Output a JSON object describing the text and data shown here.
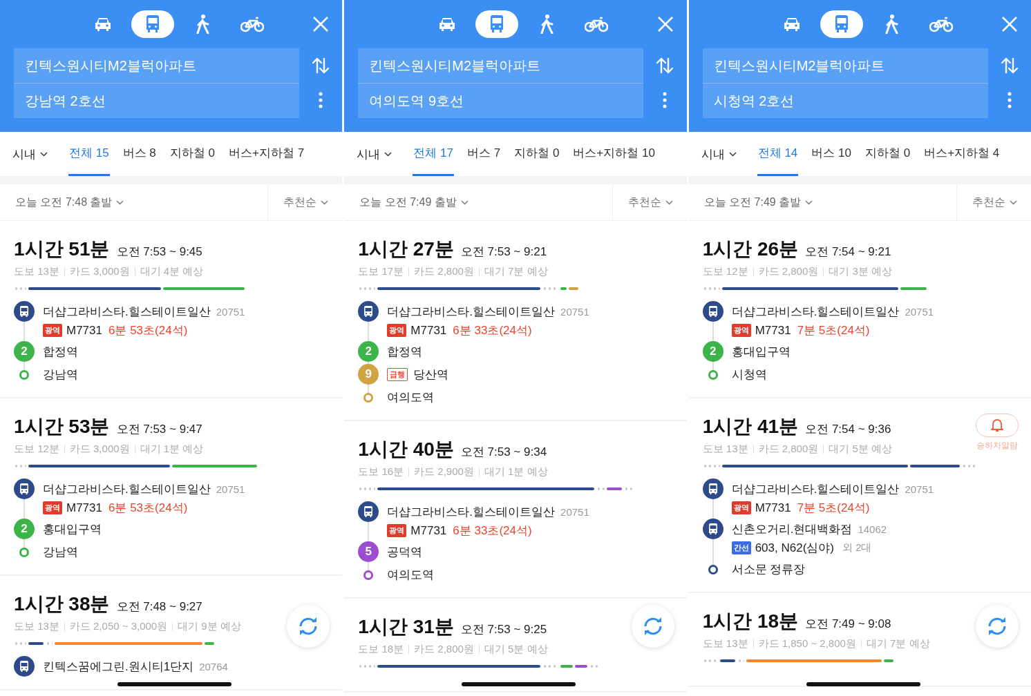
{
  "panels": [
    {
      "modes": [
        {
          "kind": "car",
          "selected": false
        },
        {
          "kind": "bus",
          "selected": true
        },
        {
          "kind": "walk",
          "selected": false
        },
        {
          "kind": "bike",
          "selected": false
        }
      ],
      "origin": "킨텍스원시티M2블럭아파트",
      "destination": "강남역 2호선",
      "region": "시내",
      "tabs": [
        {
          "label": "전체 15",
          "selected": true
        },
        {
          "label": "버스 8",
          "selected": false
        },
        {
          "label": "지하철 0",
          "selected": false
        },
        {
          "label": "버스+지하철 7",
          "selected": false
        }
      ],
      "departure": "오늘 오전 7:48 출발",
      "sort": "추천순",
      "routes": [
        {
          "duration": "1시간 51분",
          "time_range": "오전 7:53 ~ 9:45",
          "summary": [
            "도보 13분",
            "카드 3,000원",
            "대기 4분 예상"
          ],
          "segments": [
            {
              "kind": "walk"
            },
            {
              "kind": "ride",
              "color": "#2d4a8a"
            },
            {
              "kind": "ride",
              "color": "#3cb44a"
            }
          ],
          "steps": [
            {
              "kind": "bus",
              "stop": "더샵그라비스타.힐스테이트일산",
              "stop_id": "20751",
              "badge": {
                "label": "광역",
                "color": "#e03c2c"
              },
              "route": "M7731",
              "arrival": "6분 53초(24석)"
            },
            {
              "kind": "subway",
              "line": "2",
              "color": "#3cb44a",
              "station": "합정역"
            },
            {
              "kind": "end",
              "color": "#3cb44a",
              "station": "강남역"
            }
          ]
        },
        {
          "duration": "1시간 53분",
          "time_range": "오전 7:53 ~ 9:47",
          "summary": [
            "도보 12분",
            "카드 3,000원",
            "대기 1분 예상"
          ],
          "segments": [
            {
              "kind": "walk"
            },
            {
              "kind": "ride",
              "color": "#2d4a8a"
            },
            {
              "kind": "ride",
              "color": "#3cb44a"
            }
          ],
          "steps": [
            {
              "kind": "bus",
              "stop": "더샵그라비스타.힐스테이트일산",
              "stop_id": "20751",
              "badge": {
                "label": "광역",
                "color": "#e03c2c"
              },
              "route": "M7731",
              "arrival": "6분 53초(24석)"
            },
            {
              "kind": "subway",
              "line": "2",
              "color": "#3cb44a",
              "station": "홍대입구역"
            },
            {
              "kind": "end",
              "color": "#3cb44a",
              "station": "강남역"
            }
          ]
        },
        {
          "duration": "1시간 38분",
          "time_range": "오전 7:48 ~ 9:27",
          "summary": [
            "도보 13분",
            "카드 2,050 ~ 3,000원",
            "대기 9분 예상"
          ],
          "segments": [
            {
              "kind": "walk"
            },
            {
              "kind": "ride",
              "color": "#2d4a8a"
            },
            {
              "kind": "walk"
            },
            {
              "kind": "ride",
              "color": "#f5872f"
            },
            {
              "kind": "ride",
              "color": "#3cb44a"
            }
          ],
          "steps": [
            {
              "kind": "bus",
              "stop": "킨텍스꿈에그린.원시티1단지",
              "stop_id": "20764"
            }
          ]
        }
      ]
    },
    {
      "modes": [
        {
          "kind": "car",
          "selected": false
        },
        {
          "kind": "bus",
          "selected": true
        },
        {
          "kind": "walk",
          "selected": false
        },
        {
          "kind": "bike",
          "selected": false
        }
      ],
      "origin": "킨텍스원시티M2블럭아파트",
      "destination": "여의도역 9호선",
      "region": "시내",
      "tabs": [
        {
          "label": "전체 17",
          "selected": true
        },
        {
          "label": "버스 7",
          "selected": false
        },
        {
          "label": "지하철 0",
          "selected": false
        },
        {
          "label": "버스+지하철 10",
          "selected": false
        }
      ],
      "departure": "오늘 오전 7:49 출발",
      "sort": "추천순",
      "routes": [
        {
          "duration": "1시간 27분",
          "time_range": "오전 7:53 ~ 9:21",
          "summary": [
            "도보 17분",
            "카드 2,800원",
            "대기 7분 예상"
          ],
          "segments": [
            {
              "kind": "walk"
            },
            {
              "kind": "ride",
              "color": "#2d4a8a"
            },
            {
              "kind": "walk"
            },
            {
              "kind": "ride",
              "color": "#3cb44a"
            },
            {
              "kind": "ride",
              "color": "#d0a440"
            }
          ],
          "steps": [
            {
              "kind": "bus",
              "stop": "더샵그라비스타.힐스테이트일산",
              "stop_id": "20751",
              "badge": {
                "label": "광역",
                "color": "#e03c2c"
              },
              "route": "M7731",
              "arrival": "6분 33초(24석)"
            },
            {
              "kind": "subway",
              "line": "2",
              "color": "#3cb44a",
              "station": "합정역"
            },
            {
              "kind": "subway",
              "line": "9",
              "color": "#d0a440",
              "station": "당산역",
              "tag": "급행"
            },
            {
              "kind": "end",
              "color": "#d0a440",
              "station": "여의도역"
            }
          ]
        },
        {
          "duration": "1시간 40분",
          "time_range": "오전 7:53 ~ 9:34",
          "summary": [
            "도보 16분",
            "카드 2,900원",
            "대기 1분 예상"
          ],
          "segments": [
            {
              "kind": "walk"
            },
            {
              "kind": "ride",
              "color": "#2d4a8a"
            },
            {
              "kind": "walk"
            },
            {
              "kind": "ride",
              "color": "#9b4fd0"
            },
            {
              "kind": "walk"
            }
          ],
          "steps": [
            {
              "kind": "bus",
              "stop": "더샵그라비스타.힐스테이트일산",
              "stop_id": "20751",
              "badge": {
                "label": "광역",
                "color": "#e03c2c"
              },
              "route": "M7731",
              "arrival": "6분 33초(24석)"
            },
            {
              "kind": "subway",
              "line": "5",
              "color": "#9b4fd0",
              "station": "공덕역"
            },
            {
              "kind": "end",
              "color": "#9b4fd0",
              "station": "여의도역"
            }
          ]
        },
        {
          "duration": "1시간 31분",
          "time_range": "오전 7:53 ~ 9:25",
          "summary": [
            "도보 18분",
            "카드 2,800원",
            "대기 5분 예상"
          ],
          "segments": [
            {
              "kind": "walk"
            },
            {
              "kind": "ride",
              "color": "#2d4a8a"
            },
            {
              "kind": "walk"
            },
            {
              "kind": "ride",
              "color": "#3cb44a"
            },
            {
              "kind": "ride",
              "color": "#9b4fd0"
            },
            {
              "kind": "walk"
            }
          ]
        }
      ]
    },
    {
      "modes": [
        {
          "kind": "car",
          "selected": false
        },
        {
          "kind": "bus",
          "selected": true
        },
        {
          "kind": "walk",
          "selected": false
        },
        {
          "kind": "bike",
          "selected": false
        }
      ],
      "origin": "킨텍스원시티M2블럭아파트",
      "destination": "시청역 2호선",
      "region": "시내",
      "tabs": [
        {
          "label": "전체 14",
          "selected": true
        },
        {
          "label": "버스 10",
          "selected": false
        },
        {
          "label": "지하철 0",
          "selected": false
        },
        {
          "label": "버스+지하철 4",
          "selected": false
        }
      ],
      "departure": "오늘 오전 7:49 출발",
      "sort": "추천순",
      "routes": [
        {
          "duration": "1시간 26분",
          "time_range": "오전 7:54 ~ 9:21",
          "summary": [
            "도보 12분",
            "카드 2,800원",
            "대기 3분 예상"
          ],
          "segments": [
            {
              "kind": "walk"
            },
            {
              "kind": "ride",
              "color": "#2d4a8a"
            },
            {
              "kind": "ride",
              "color": "#3cb44a"
            }
          ],
          "steps": [
            {
              "kind": "bus",
              "stop": "더샵그라비스타.힐스테이트일산",
              "stop_id": "20751",
              "badge": {
                "label": "광역",
                "color": "#e03c2c"
              },
              "route": "M7731",
              "arrival": "7분 5초(24석)"
            },
            {
              "kind": "subway",
              "line": "2",
              "color": "#3cb44a",
              "station": "홍대입구역"
            },
            {
              "kind": "end",
              "color": "#3cb44a",
              "station": "시청역"
            }
          ]
        },
        {
          "duration": "1시간 41분",
          "time_range": "오전 7:54 ~ 9:36",
          "summary": [
            "도보 13분",
            "카드 2,800원",
            "대기 5분 예상"
          ],
          "alarm": "승하차알람",
          "segments": [
            {
              "kind": "walk"
            },
            {
              "kind": "ride",
              "color": "#2d4a8a"
            },
            {
              "kind": "ride",
              "color": "#2d4a8a"
            },
            {
              "kind": "walk"
            }
          ],
          "steps": [
            {
              "kind": "bus",
              "stop": "더샵그라비스타.힐스테이트일산",
              "stop_id": "20751",
              "badge": {
                "label": "광역",
                "color": "#e03c2c"
              },
              "route": "M7731",
              "arrival": "7분 5초(24석)"
            },
            {
              "kind": "bus",
              "stop": "신촌오거리.현대백화점",
              "stop_id": "14062",
              "badge": {
                "label": "간선",
                "color": "#3d6ae6"
              },
              "route": "603, N62(심야)",
              "extra": "외 2대"
            },
            {
              "kind": "end",
              "color": "#2d4a8a",
              "station": "서소문 정류장"
            }
          ]
        },
        {
          "duration": "1시간 18분",
          "time_range": "오전 7:49 ~ 9:08",
          "summary": [
            "도보 13분",
            "카드 1,850 ~ 2,800원",
            "대기 7분 예상"
          ],
          "segments": [
            {
              "kind": "walk"
            },
            {
              "kind": "ride",
              "color": "#2d4a8a"
            },
            {
              "kind": "walk"
            },
            {
              "kind": "ride",
              "color": "#f5872f"
            },
            {
              "kind": "ride",
              "color": "#3cb44a"
            }
          ]
        }
      ]
    }
  ]
}
